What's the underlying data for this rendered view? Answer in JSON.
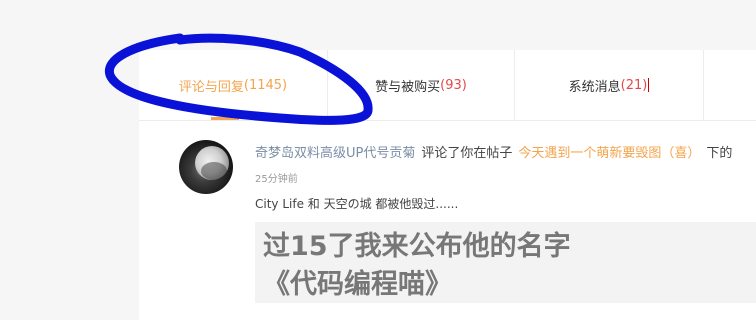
{
  "tabs": [
    {
      "label": "评论与回复",
      "count": "(1145)",
      "active": true
    },
    {
      "label": "赞与被购买",
      "count": "(93)",
      "active": false
    },
    {
      "label": "系统消息",
      "count": "(21)",
      "active": false
    }
  ],
  "notification": {
    "user": "奇梦岛双料高级UP代号贡菊",
    "action": "评论了你在帖子",
    "post_title": "今天遇到一个萌新要毁图（喜）",
    "trailing": "下的",
    "time": "25分钟前",
    "preview": "City Life 和 天空の城 都被他毁过......",
    "quote_line1": "过15了我来公布他的名字",
    "quote_line2": "《代码编程喵》"
  },
  "colors": {
    "accent": "#f4a44c",
    "count_red": "#e24a4a",
    "username": "#7b8ea6",
    "annotation_blue": "#0a12d8"
  }
}
